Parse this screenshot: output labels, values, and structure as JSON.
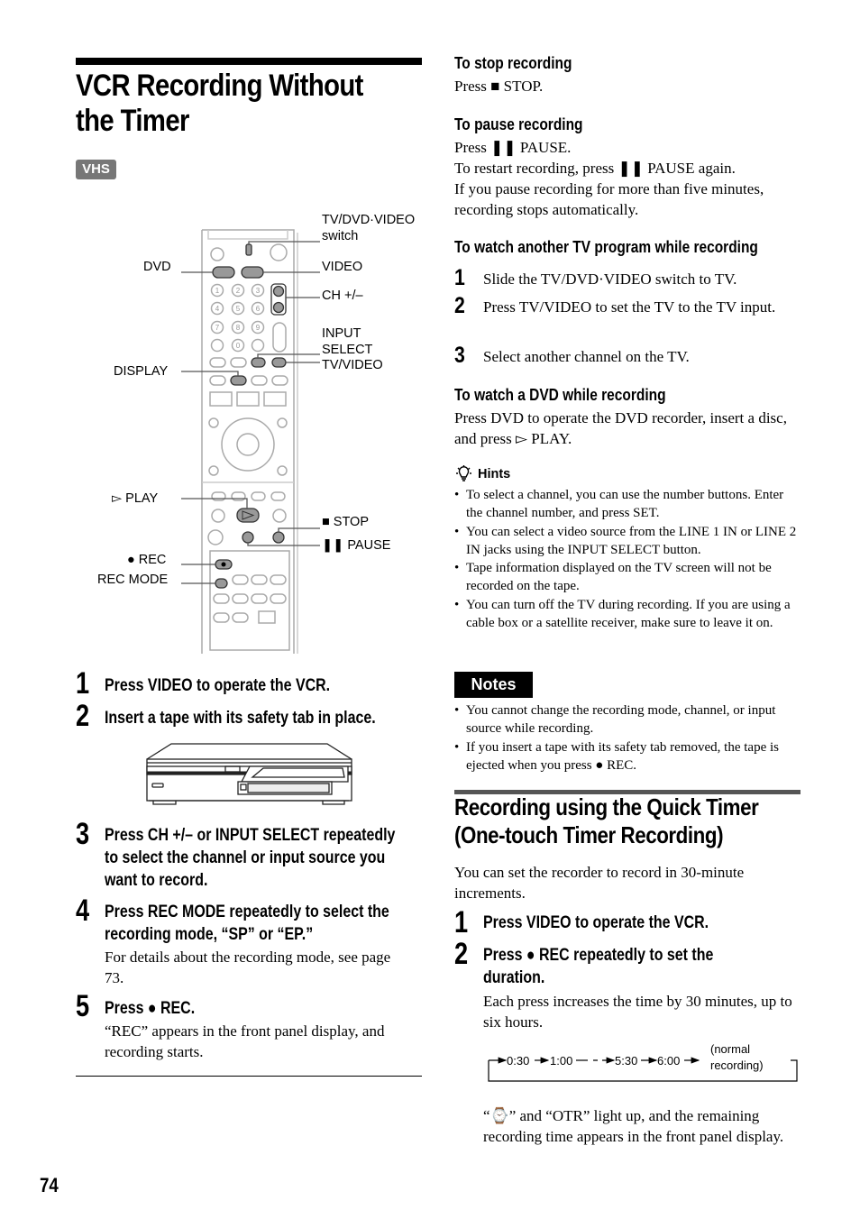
{
  "page": {
    "title": "VCR Recording Without the Timer",
    "badge": "VHS",
    "page_number": "74"
  },
  "remote_labels": {
    "tv_dvd_video_switch_line1": "TV/DVD·VIDEO",
    "tv_dvd_video_switch_line2": "switch",
    "dvd": "DVD",
    "video": "VIDEO",
    "ch": "CH +/–",
    "input_select_line1": "INPUT",
    "input_select_line2": "SELECT",
    "tv_video": "TV/VIDEO",
    "display": "DISPLAY",
    "play": "▻ PLAY",
    "stop": "■ STOP",
    "pause": "❚❚ PAUSE",
    "rec": "● REC",
    "rec_mode": "REC MODE",
    "number_keys": [
      "1",
      "2",
      "3",
      "4",
      "5",
      "6",
      "7",
      "8",
      "9",
      "0"
    ]
  },
  "steps": [
    {
      "num": "1",
      "text": "Press VIDEO to operate the VCR."
    },
    {
      "num": "2",
      "text": "Insert a tape with its safety tab in place."
    },
    {
      "num": "3",
      "lines": [
        "Press CH +/– or INPUT SELECT repeatedly",
        "to select the channel or input source you",
        "want to record."
      ]
    },
    {
      "num": "4",
      "lines": [
        "Press REC MODE repeatedly to select the",
        "recording mode, “SP” or “EP.”"
      ],
      "body": "For details about the recording mode, see page 73."
    },
    {
      "num": "5",
      "text": "Press ● REC.",
      "body": "“REC” appears in the front panel display, and recording starts."
    }
  ],
  "stop_recording": {
    "heading": "To stop recording",
    "body": "Press ■ STOP."
  },
  "pause_recording": {
    "heading": "To pause recording",
    "lines": [
      "Press ❚❚ PAUSE.",
      "To restart recording, press ❚❚ PAUSE again.",
      "If you pause recording for more than five minutes, recording stops automatically."
    ]
  },
  "watch_tv": {
    "heading": "To watch another TV program while recording",
    "steps": [
      {
        "num": "1",
        "text": "Slide the TV/DVD·VIDEO switch to TV."
      },
      {
        "num": "2",
        "text": "Press TV/VIDEO to set the TV to the TV input."
      },
      {
        "num": "3",
        "text": "Select another channel on the TV."
      }
    ]
  },
  "watch_dvd": {
    "heading": "To watch a DVD while recording",
    "body": "Press DVD to operate the DVD recorder, insert a disc, and press ▻ PLAY."
  },
  "hints": {
    "title": "Hints",
    "items": [
      "To select a channel, you can use the number buttons. Enter the channel number, and press SET.",
      "You can select a video source from the LINE 1 IN or LINE 2 IN jacks using the INPUT SELECT button.",
      "Tape information displayed on the TV screen will not be recorded on the tape.",
      "You can turn off the TV during recording. If you are using a cable box or a satellite receiver, make sure to leave it on."
    ]
  },
  "notes": {
    "title": "Notes",
    "items": [
      "You cannot change the recording mode, channel, or input source while recording.",
      "If you insert a tape with its safety tab removed, the tape is ejected when you press ● REC."
    ]
  },
  "quick_timer": {
    "title_line1": "Recording using the Quick Timer",
    "title_line2": "(One-touch Timer Recording)",
    "intro": "You can set the recorder to record in 30-minute increments.",
    "steps": [
      {
        "num": "1",
        "text": "Press VIDEO to operate the VCR."
      },
      {
        "num": "2",
        "lines": [
          "Press ● REC repeatedly to set the",
          "duration."
        ],
        "body": "Each press increases the time by 30 minutes, up to six hours."
      }
    ],
    "sequence": [
      "0:30",
      "1:00",
      "5:30",
      "6:00"
    ],
    "sequence_end_line1": "(normal",
    "sequence_end_line2": "recording)",
    "result": "“⌚” and “OTR” light up, and the remaining recording time appears in the front panel display."
  }
}
